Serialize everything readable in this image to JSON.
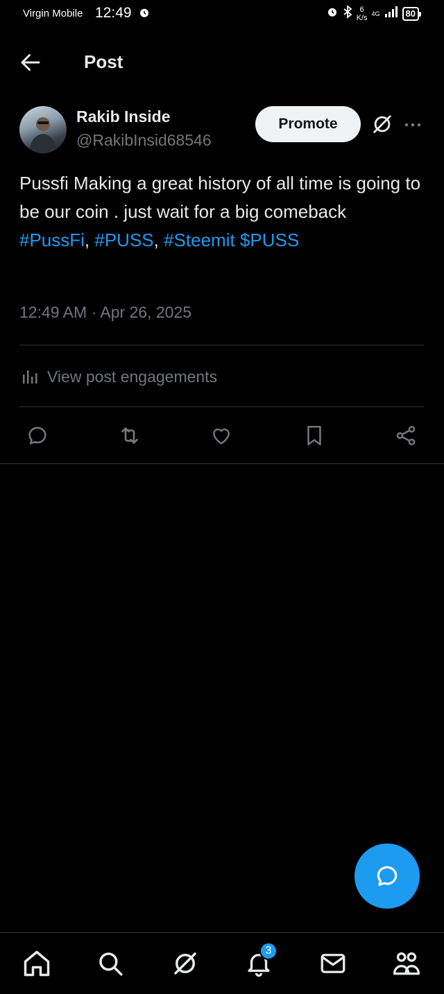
{
  "status_bar": {
    "carrier": "Virgin Mobile",
    "time": "12:49",
    "speed_value": "6",
    "speed_unit": "K/s",
    "network": "4G",
    "battery": "80"
  },
  "header": {
    "title": "Post"
  },
  "post": {
    "author_name": "Rakib Inside",
    "author_handle": "@RakibInsid68546",
    "promote_label": "Promote",
    "text_line": "Pussfi Making a great history of all time is going to be our coin . just wait for a big comeback",
    "hashtags": [
      "#PussFi",
      "#PUSS",
      "#Steemit $PUSS"
    ],
    "separator": ", ",
    "timestamp": "12:49 AM · Apr 26, 2025",
    "engagements_label": "View post engagements"
  },
  "bottom_nav": {
    "notification_count": "3"
  },
  "colors": {
    "accent": "#1d9bf0",
    "background": "#000000",
    "text_primary": "#e7e9ea",
    "text_secondary": "#71767b",
    "divider": "#2f3336"
  }
}
